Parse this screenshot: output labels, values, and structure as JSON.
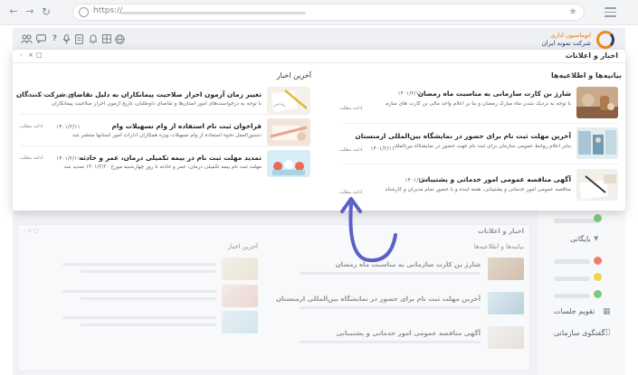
{
  "browser": {
    "url_prefix": "https://"
  },
  "brand": {
    "line1": "اتوماسیون اداری",
    "line2": "شرکت نمونه ایران"
  },
  "panel": {
    "title": "اخبار و اعلانات",
    "controls": [
      "-",
      "×",
      "□"
    ]
  },
  "announcements": {
    "title": "بیانیه‌ها و اطلاعیه‌ها",
    "items": [
      {
        "title": "شارژ بن کارت سازمانی به مناسبت ماه رمضان",
        "date": "۱۴۰۱/۲/۱۱",
        "desc": "با توجه به نزدیک شدن ماه مبارک رمضان و بنا بر اعلام واحد مالی بن کارت های سازمانی...",
        "more": "ادامه مطلب"
      },
      {
        "title": "آخرین مهلت ثبت نام برای حضور در نمایشگاه بین‌المللی ارمنستان",
        "date": "۱۴۰۱/۲/۱۱",
        "desc": "بنابر اعلام روابط عمومی سازمان برای ثبت نام جهت حضور در نمایشگاه بین‌المللی ارمنستان...",
        "more": "ادامه مطلب"
      },
      {
        "title": "آگهی مناقصه عمومی امور خدماتی و پشتیبانی",
        "date": "۱۴۰۱/۲/۱۱",
        "desc": "مناقصه عمومی امور خدماتی و پشتیبانی، هفته آینده و با حضور تمام مدیران و کارشناسان...",
        "more": "ادامه مطلب"
      }
    ]
  },
  "news": {
    "title": "آخرین اخبار",
    "items": [
      {
        "title": "تغییر زمان آزمون احراز صلاحیت پیمانکاران به دلیل تقاضای شرکت کنندگان",
        "date": "۱۴۰۱/۲/۱۱",
        "desc": "با توجه به درخواست‌های امور استان‌ها و تقاضای داوطلبان، تاریخ آزمون احراز صلاحیت پیمانکاران ...",
        "more": "ادامه مطلب"
      },
      {
        "title": "فراخوان ثبت نام استفاده از وام تسهیلات وام",
        "date": "۱۴۰۱/۲/۱۱",
        "desc": "دستورالعمل نحوه استفاده از وام تسهیلات ویژه همکاران ادارات امور استانها منتشر شد",
        "more": "ادامه مطلب"
      },
      {
        "title": "تمدید مهلت ثبت نام در بیمه تکمیلی درمان، عمر و حادثه",
        "date": "۱۴۰۱/۲/۱۱",
        "desc": "مهلت ثبت نام بیمه تکمیلی درمان، عمر و حادثه تا روز چهارشنبه مورخ ۱۴۰۱/۲/۲۰ تمدید شد",
        "more": "ادامه مطلب"
      }
    ]
  },
  "sidebar": {
    "items": [
      {
        "label": "بایگانی"
      },
      {
        "label": "تقویم جلسات"
      },
      {
        "label": "گفتگوی سازمانی"
      }
    ]
  },
  "colors": {
    "green": "#7dc97b",
    "yellow": "#f2d24a",
    "red": "#f07d6b",
    "brand_orange": "#e88a1e",
    "brand_navy": "#2b3a67",
    "arrow": "#5b5fc7"
  }
}
